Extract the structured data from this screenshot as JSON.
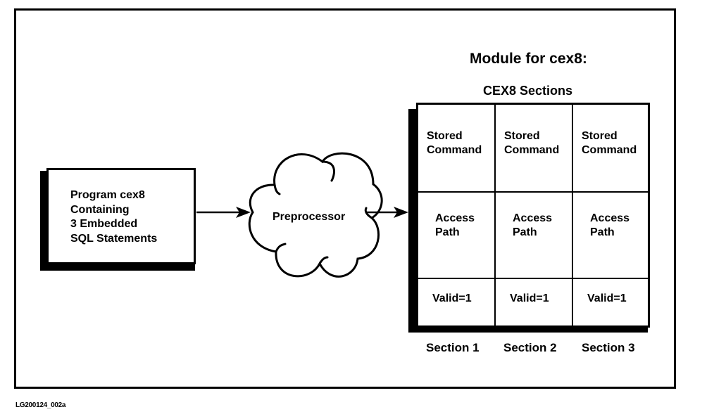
{
  "diagram": {
    "program_box": {
      "lines": [
        "Program cex8",
        "Containing",
        "3 Embedded",
        "SQL Statements"
      ]
    },
    "preprocessor": {
      "label": "Preprocessor"
    },
    "module": {
      "title": "Module for cex8:",
      "subtitle": "CEX8 Sections",
      "rows": [
        {
          "name": "stored-command",
          "cells": [
            [
              "Stored",
              "Command"
            ],
            [
              "Stored",
              "Command"
            ],
            [
              "Stored",
              "Command"
            ]
          ]
        },
        {
          "name": "access-path",
          "cells": [
            [
              "Access",
              "Path"
            ],
            [
              "Access",
              "Path"
            ],
            [
              "Access",
              "Path"
            ]
          ]
        },
        {
          "name": "valid",
          "cells": [
            [
              "Valid=1"
            ],
            [
              "Valid=1"
            ],
            [
              "Valid=1"
            ]
          ]
        }
      ],
      "section_labels": [
        "Section 1",
        "Section 2",
        "Section 3"
      ]
    },
    "figure_id": "LG200124_002a",
    "colors": {
      "ink": "#000000",
      "paper": "#ffffff"
    }
  }
}
